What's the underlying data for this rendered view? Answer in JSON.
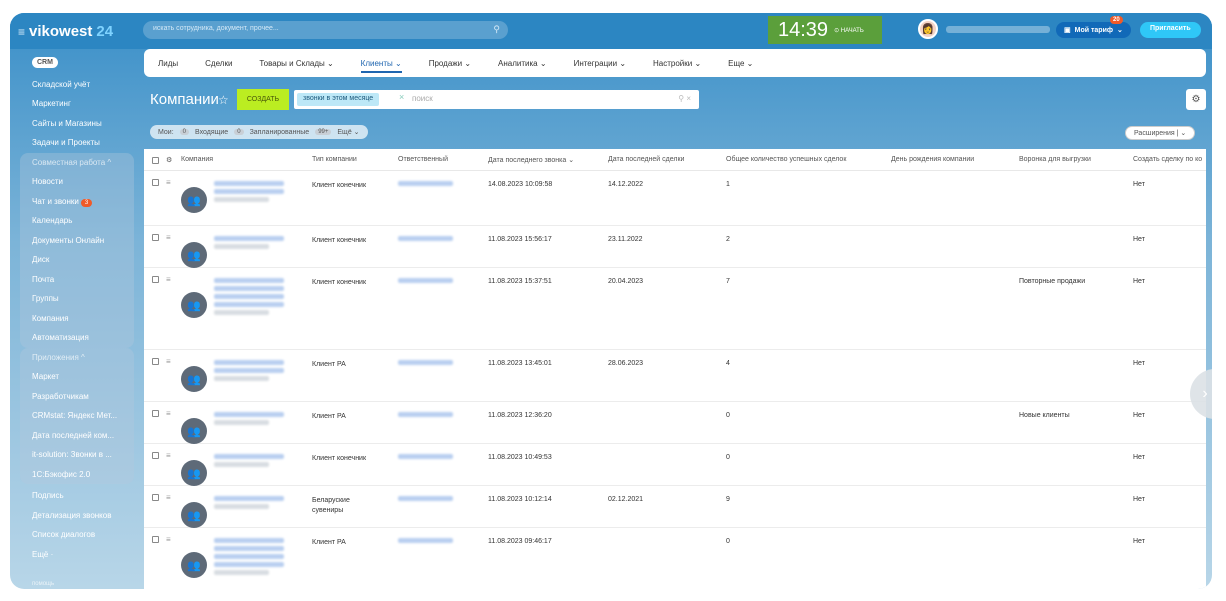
{
  "topbar": {
    "logo_text": "vikowest",
    "logo_num": "24",
    "search_placeholder": "искать сотрудника, документ, прочее...",
    "clock_time": "14:39",
    "clock_start": "⊙ НАЧАТЬ",
    "tariff_label": "Мой тариф",
    "tariff_badge": "20",
    "invite_label": "Пригласить"
  },
  "sidebar": {
    "items": [
      {
        "label": "CRM",
        "type": "crm"
      },
      {
        "label": "Складской учёт"
      },
      {
        "label": "Маркетинг"
      },
      {
        "label": "Сайты и Магазины"
      },
      {
        "label": "Задачи и Проекты"
      },
      {
        "label": "Совместная работа ^",
        "dim": true
      },
      {
        "label": "Новости"
      },
      {
        "label": "Чат и звонки",
        "count": "3"
      },
      {
        "label": "Календарь"
      },
      {
        "label": "Документы Онлайн"
      },
      {
        "label": "Диск"
      },
      {
        "label": "Почта"
      },
      {
        "label": "Группы"
      },
      {
        "label": "Компания"
      },
      {
        "label": "Автоматизация"
      },
      {
        "label": "Приложения ^",
        "dim": true
      },
      {
        "label": "Маркет"
      },
      {
        "label": "Разработчикам"
      },
      {
        "label": "CRMstat: Яндекс Мет..."
      },
      {
        "label": "Дата последней ком..."
      },
      {
        "label": "it-solution: Звонки в ..."
      },
      {
        "label": "1С:Бэкофис 2.0"
      },
      {
        "label": "Подпись"
      },
      {
        "label": "Детализация звонков"
      },
      {
        "label": "Список диалогов"
      },
      {
        "label": "Ещё ·"
      },
      {
        "label": "помощь",
        "help": true
      }
    ]
  },
  "tabs": [
    {
      "label": "Лиды"
    },
    {
      "label": "Сделки"
    },
    {
      "label": "Товары и Склады ⌄"
    },
    {
      "label": "Клиенты ⌄",
      "active": true
    },
    {
      "label": "Продажи ⌄"
    },
    {
      "label": "Аналитика ⌄"
    },
    {
      "label": "Интеграции ⌄"
    },
    {
      "label": "Настройки ⌄"
    },
    {
      "label": "Еще ⌄"
    }
  ],
  "header": {
    "title": "Компании",
    "create_label": "СОЗДАТЬ",
    "filter_chip": "звонки в этом месяце",
    "filter_placeholder": "поиск"
  },
  "counters": {
    "label": "Мои:",
    "incoming_count": "0",
    "incoming_label": "Входящие",
    "planned_count": "0",
    "planned_label": "Запланированные",
    "more_count": "99+",
    "more_label": "Ещё ⌄"
  },
  "extensions_label": "Расширения | ⌄",
  "columns": [
    "Компания",
    "Тип компании",
    "Ответственный",
    "Дата последнего звонка ⌄",
    "Дата последней сделки",
    "Общее количество успешных сделок",
    "День рождения компании",
    "Воронка для выгрузки",
    "Создать сделку по ко"
  ],
  "rows": [
    {
      "type": "Клиент конечник",
      "call": "14.08.2023 10:09:58",
      "deal": "14.12.2022",
      "count": "1",
      "funnel": "",
      "create": "Нет"
    },
    {
      "type": "Клиент конечник",
      "call": "11.08.2023 15:56:17",
      "deal": "23.11.2022",
      "count": "2",
      "funnel": "",
      "create": "Нет"
    },
    {
      "type": "Клиент конечник",
      "call": "11.08.2023 15:37:51",
      "deal": "20.04.2023",
      "count": "7",
      "funnel": "Повторные продажи",
      "create": "Нет"
    },
    {
      "type": "Клиент РА",
      "call": "11.08.2023 13:45:01",
      "deal": "28.06.2023",
      "count": "4",
      "funnel": "",
      "create": "Нет"
    },
    {
      "type": "Клиент РА",
      "call": "11.08.2023 12:36:20",
      "deal": "",
      "count": "0",
      "funnel": "Новые клиенты",
      "create": "Нет"
    },
    {
      "type": "Клиент конечник",
      "call": "11.08.2023 10:49:53",
      "deal": "",
      "count": "0",
      "funnel": "",
      "create": "Нет"
    },
    {
      "type": "Беларуские\nсувениры",
      "call": "11.08.2023 10:12:14",
      "deal": "02.12.2021",
      "count": "9",
      "funnel": "",
      "create": "Нет"
    },
    {
      "type": "Клиент РА",
      "call": "11.08.2023 09:46:17",
      "deal": "",
      "count": "0",
      "funnel": "",
      "create": "Нет"
    }
  ],
  "colors": {
    "accent": "#2066b0",
    "create": "#bbed21",
    "clock": "#5b9f3b",
    "topbar": "#2c86c2"
  }
}
